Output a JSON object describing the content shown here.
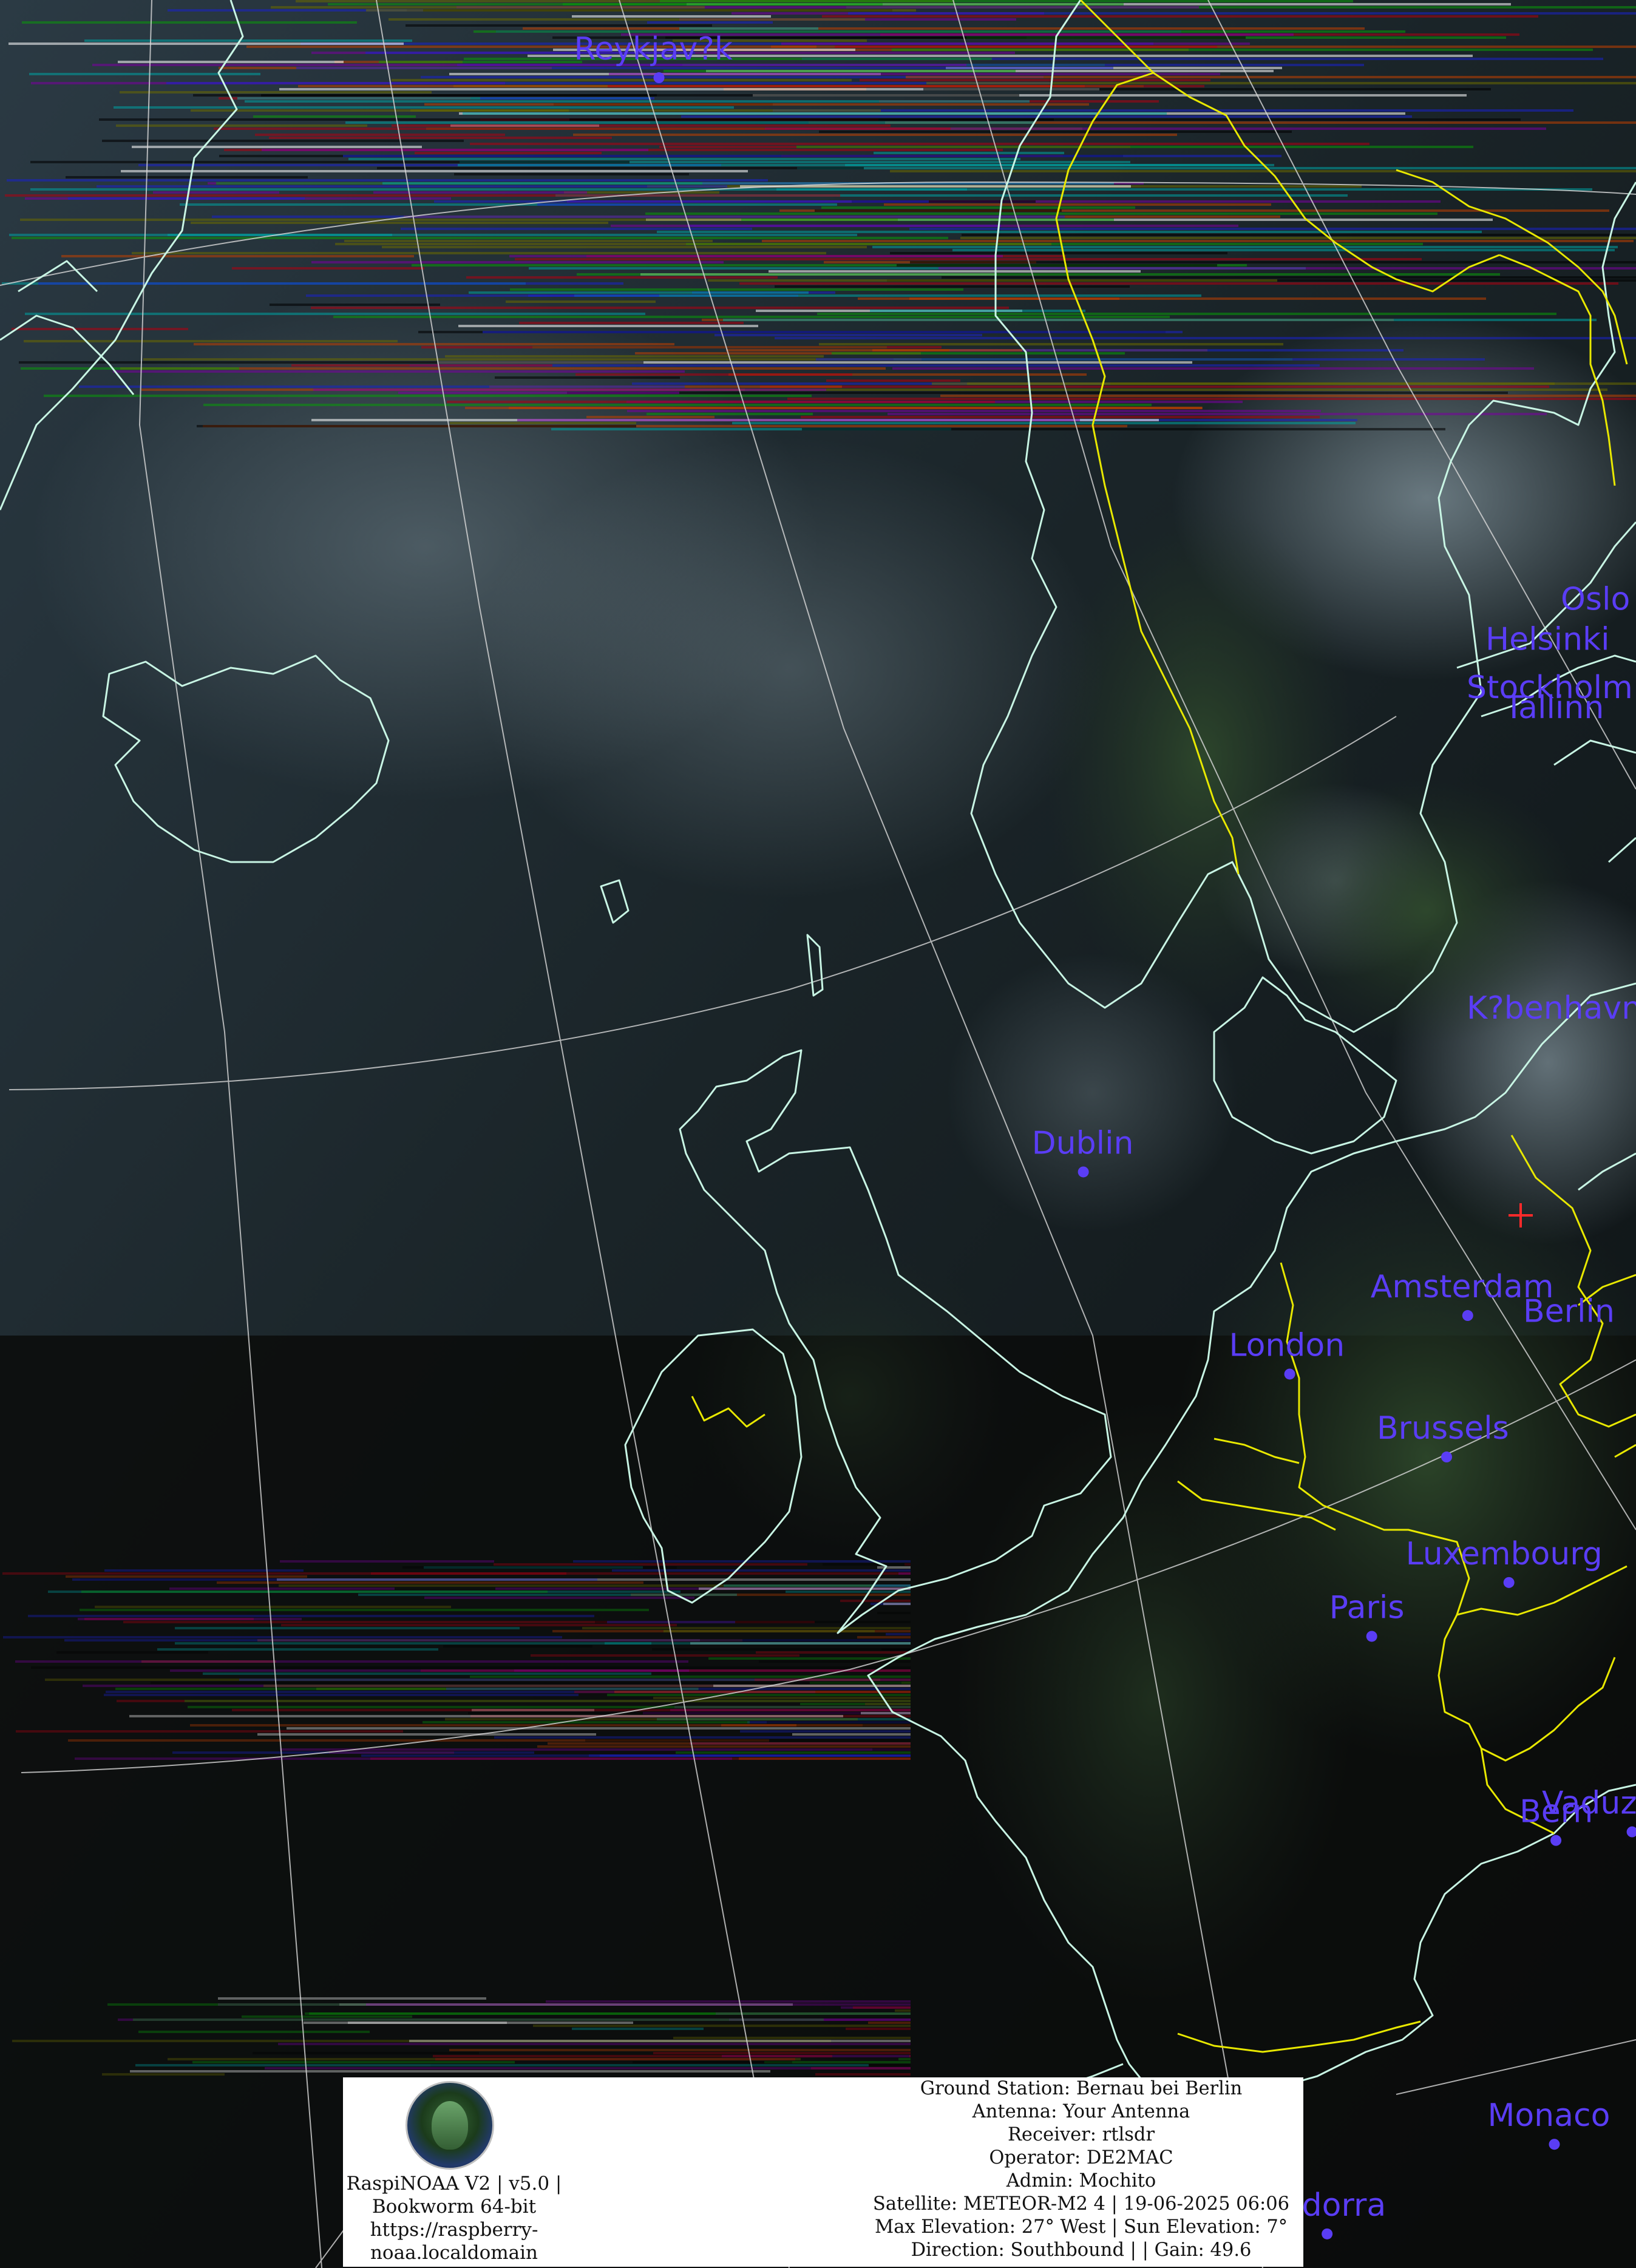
{
  "map": {
    "cities": [
      {
        "name": "Helsinki",
        "lon": 24.94,
        "lat": 60.17
      },
      {
        "name": "Tallinn",
        "lon": 24.75,
        "lat": 59.44
      },
      {
        "name": "Stockholm",
        "lon": 18.07,
        "lat": 59.33
      },
      {
        "name": "Reykjav?k",
        "lon": -21.94,
        "lat": 64.15
      },
      {
        "name": "Oslo",
        "lon": 10.75,
        "lat": 59.91
      },
      {
        "name": "K?benhavn",
        "lon": 12.57,
        "lat": 55.68
      },
      {
        "name": "Berlin",
        "lon": 13.4,
        "lat": 52.52
      },
      {
        "name": "Amsterdam",
        "lon": 4.9,
        "lat": 52.37
      },
      {
        "name": "Dublin",
        "lon": -6.26,
        "lat": 53.35
      },
      {
        "name": "London",
        "lon": -0.13,
        "lat": 51.51
      },
      {
        "name": "Brussels",
        "lon": 4.35,
        "lat": 50.85
      },
      {
        "name": "Luxembourg",
        "lon": 6.13,
        "lat": 49.61
      },
      {
        "name": "Paris",
        "lon": 2.35,
        "lat": 48.86
      },
      {
        "name": "Vaduz",
        "lon": 9.52,
        "lat": 47.14
      },
      {
        "name": "Bern",
        "lon": 7.45,
        "lat": 46.95
      },
      {
        "name": "Monaco",
        "lon": 7.42,
        "lat": 43.74
      },
      {
        "name": "Andorra",
        "lon": 1.52,
        "lat": 42.51
      }
    ],
    "colors": {
      "coastline": "#c8f5e4",
      "border": "#e8e800",
      "graticule": "#d8d8d8",
      "city": "#5a3df5",
      "ground_station_marker": "#ff2a2a"
    }
  },
  "info": {
    "logo_icon": "raspinoaa-globe-logo",
    "left_lines": [
      "RaspiNOAA V2 | v5.0 |",
      "Bookworm 64-bit",
      "https://raspberry-",
      "noaa.localdomain"
    ],
    "station_lines": [
      "Ground Station: Bernau bei Berlin",
      "Antenna: Your Antenna",
      "Receiver: rtlsdr",
      "Operator: DE2MAC",
      "Admin: Mochito",
      "Satellite: METEOR-M2 4 | 19-06-2025 06:06",
      "Max Elevation: 27° West | Sun Elevation: 7°",
      "Direction: Southbound | | Gain: 49.6"
    ]
  }
}
